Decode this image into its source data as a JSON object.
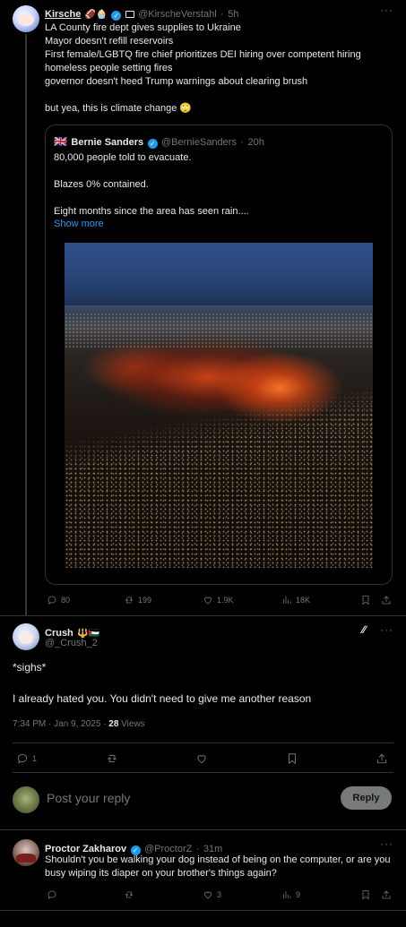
{
  "original_tweet": {
    "name": "Kirsche",
    "name_emojis": "🏈🧁",
    "handle": "@KirscheVerstahl",
    "time": "5h",
    "text": "LA County fire dept gives supplies to Ukraine\nMayor doesn't refill reservoirs\nFirst female/LGBTQ fire chief prioritizes DEI hiring over competent hiring\nhomeless people setting fires\ngovernor doesn't heed Trump warnings about clearing brush\n\nbut yea, this is climate change 🙄",
    "stats": {
      "replies": "80",
      "reposts": "199",
      "likes": "1.9K",
      "views": "18K"
    }
  },
  "quoted_tweet": {
    "flag": "🇬🇧",
    "name": "Bernie Sanders",
    "handle": "@BernieSanders",
    "time": "20h",
    "line1": "80,000 people told to evacuate.",
    "line2": "Blazes 0% contained.",
    "line3": "Eight months since the area has seen rain....",
    "show_more": "Show more"
  },
  "focused_tweet": {
    "name": "Crush",
    "name_emojis": "🔱🇵🇸",
    "handle": "@_Crush_2",
    "line1": "*sighs*",
    "line2": "I already hated you. You didn't need to give me another reason",
    "timestamp": "7:34 PM · Jan 9, 2025 · ",
    "views_count": "28",
    "views_label": " Views",
    "stats": {
      "replies": "1"
    }
  },
  "composer": {
    "placeholder": "Post your reply",
    "button": "Reply"
  },
  "reply_tweet": {
    "name": "Proctor Zakharov",
    "handle": "@ProctorZ",
    "time": "31m",
    "text": "Shouldn't you be walking your dog instead of being on the computer, or are you busy wiping its diaper on your brother's things again?",
    "stats": {
      "likes": "3",
      "views": "9"
    }
  },
  "icons": {
    "verified": "verified-badge-icon",
    "more": "more-icon",
    "grok": "grok-icon"
  },
  "colors": {
    "accent": "#1d9bf0",
    "background": "#000000",
    "muted": "#71767b",
    "border": "#2f3336"
  }
}
